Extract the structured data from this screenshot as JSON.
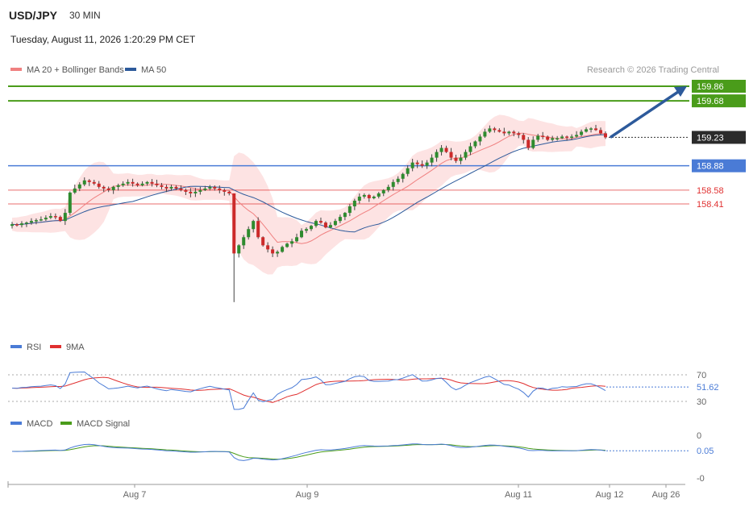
{
  "header": {
    "symbol": "USD/JPY",
    "timeframe": "30 MIN",
    "datetime": "Tuesday, August 11, 2026 1:20:29 PM CET",
    "credit": "Research © 2026 Trading Central"
  },
  "legend": {
    "ma20_label": "MA 20 + Bollinger Bands",
    "ma50_label": "MA 50",
    "rsi_label": "RSI",
    "rsi_ma_label": "9MA",
    "macd_label": "MACD",
    "macd_signal_label": "MACD Signal"
  },
  "colors": {
    "ma20": "#f08080",
    "ma50": "#2d5a9b",
    "bands_fill": "#fde3e3",
    "resistance": "#4a9c1a",
    "pivot": "#4a7bd6",
    "support": "#e03030",
    "last_price": "#2b2b2b",
    "candle_up": "#2e8b2e",
    "candle_down": "#cc2a2a",
    "rsi": "#4a7bd6",
    "rsi_ma": "#e03030",
    "macd": "#4a7bd6",
    "macd_signal": "#4a9c1a",
    "arrow": "#2d5a9b"
  },
  "chart_data": {
    "type": "candlestick",
    "symbol": "USD/JPY",
    "interval": "30 MIN",
    "price_axis": {
      "min": 157.0,
      "max": 160.0
    },
    "x_tick_labels": [
      "Aug 7",
      "Aug 9",
      "Aug 11",
      "Aug 12",
      "Aug 26"
    ],
    "levels": [
      {
        "value": 159.86,
        "label": "159.86",
        "kind": "resistance"
      },
      {
        "value": 159.68,
        "label": "159.68",
        "kind": "resistance"
      },
      {
        "value": 159.23,
        "label": "159.23",
        "kind": "last"
      },
      {
        "value": 158.88,
        "label": "158.88",
        "kind": "pivot"
      },
      {
        "value": 158.58,
        "label": "158.58",
        "kind": "support"
      },
      {
        "value": 158.41,
        "label": "158.41",
        "kind": "support"
      }
    ],
    "forecast_arrow": {
      "from": 159.23,
      "to": 159.86
    },
    "close_series": [
      158.16,
      158.15,
      158.17,
      158.18,
      158.2,
      158.21,
      158.22,
      158.24,
      158.26,
      158.25,
      158.2,
      158.3,
      158.55,
      158.6,
      158.65,
      158.7,
      158.68,
      158.66,
      158.62,
      158.6,
      158.58,
      158.62,
      158.64,
      158.66,
      158.68,
      158.66,
      158.64,
      158.66,
      158.68,
      158.66,
      158.64,
      158.62,
      158.6,
      158.62,
      158.6,
      158.58,
      158.56,
      158.54,
      158.56,
      158.58,
      158.6,
      158.62,
      158.6,
      158.58,
      158.56,
      158.54,
      157.8,
      157.9,
      158.0,
      158.1,
      158.2,
      158.0,
      157.9,
      157.85,
      157.8,
      157.82,
      157.88,
      157.92,
      157.95,
      158.0,
      158.08,
      158.1,
      158.14,
      158.2,
      158.18,
      158.12,
      158.15,
      158.2,
      158.25,
      158.3,
      158.38,
      158.45,
      158.5,
      158.52,
      158.48,
      158.5,
      158.54,
      158.58,
      158.62,
      158.68,
      158.72,
      158.78,
      158.85,
      158.92,
      158.9,
      158.88,
      158.92,
      158.98,
      159.05,
      159.1,
      159.05,
      158.98,
      158.94,
      158.98,
      159.05,
      159.12,
      159.18,
      159.24,
      159.3,
      159.34,
      159.32,
      159.3,
      159.28,
      159.3,
      159.28,
      159.26,
      159.2,
      159.1,
      159.2,
      159.25,
      159.24,
      159.2,
      159.22,
      159.22,
      159.24,
      159.23,
      159.24,
      159.26,
      159.3,
      159.33,
      159.34,
      159.32,
      159.28,
      159.23
    ],
    "rsi": {
      "last": 51.62,
      "levels": [
        70,
        30
      ],
      "last_label": "51.62",
      "tick_labels": [
        "70",
        "30"
      ]
    },
    "macd": {
      "last": 0.05,
      "last_label": "0.05",
      "tick_labels": [
        "0",
        "-0"
      ]
    }
  }
}
